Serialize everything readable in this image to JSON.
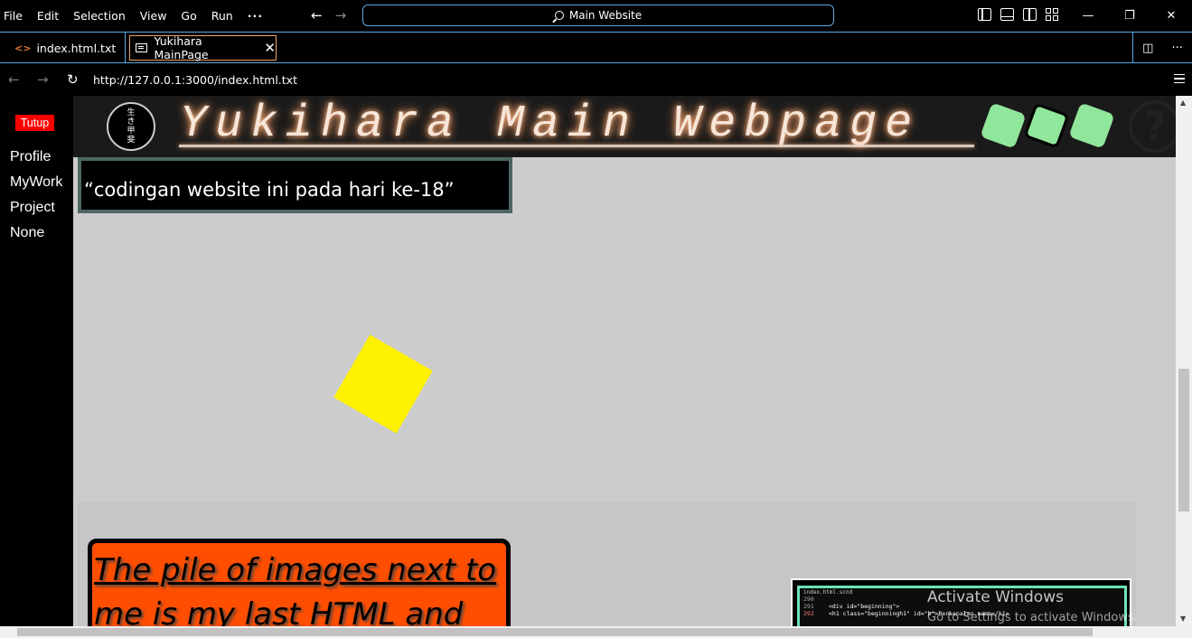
{
  "menu": [
    "File",
    "Edit",
    "Selection",
    "View",
    "Go",
    "Run",
    "···"
  ],
  "command_center": {
    "label": "Main Website",
    "icon": "search-icon"
  },
  "tabs": [
    {
      "label": "index.html.txt",
      "icon": "code-icon"
    },
    {
      "label": "Yukihara MainPage",
      "icon": "preview-icon",
      "close": "✕",
      "active": true
    }
  ],
  "browser": {
    "url": "http://127.0.0.1:3000/index.html.txt"
  },
  "sidebar": {
    "close_button": "Tutup",
    "items": [
      "Profile",
      "MyWork",
      "Project",
      "None"
    ]
  },
  "banner": {
    "title": "Yukihara Main Webpage",
    "logo_text": "生\nき\n甲\n斐",
    "help": "?"
  },
  "quote": "“codingan website ini pada hari ke-18”",
  "orange_box": {
    "line1": "The pile of images next to",
    "line2": "me is my last HTML and"
  },
  "code_panel": {
    "title": "index.html.scnd",
    "lines": [
      {
        "num": "290",
        "code": ""
      },
      {
        "num": "291",
        "code": "<div id=\"beginning\">"
      },
      {
        "num": "292",
        "code": "<h1 class=\"beginningh1\" id=\"b\">Perkenalan nama</h1>"
      }
    ]
  },
  "watermark": {
    "title": "Activate Windows",
    "subtitle": "Go to Settings to activate Windows."
  },
  "colors": {
    "accent_border": "#5aa9e6",
    "tutup_red": "#ff0000",
    "orange": "#ff4e00",
    "yellow": "#fff200",
    "green_tile": "#90e69a"
  }
}
